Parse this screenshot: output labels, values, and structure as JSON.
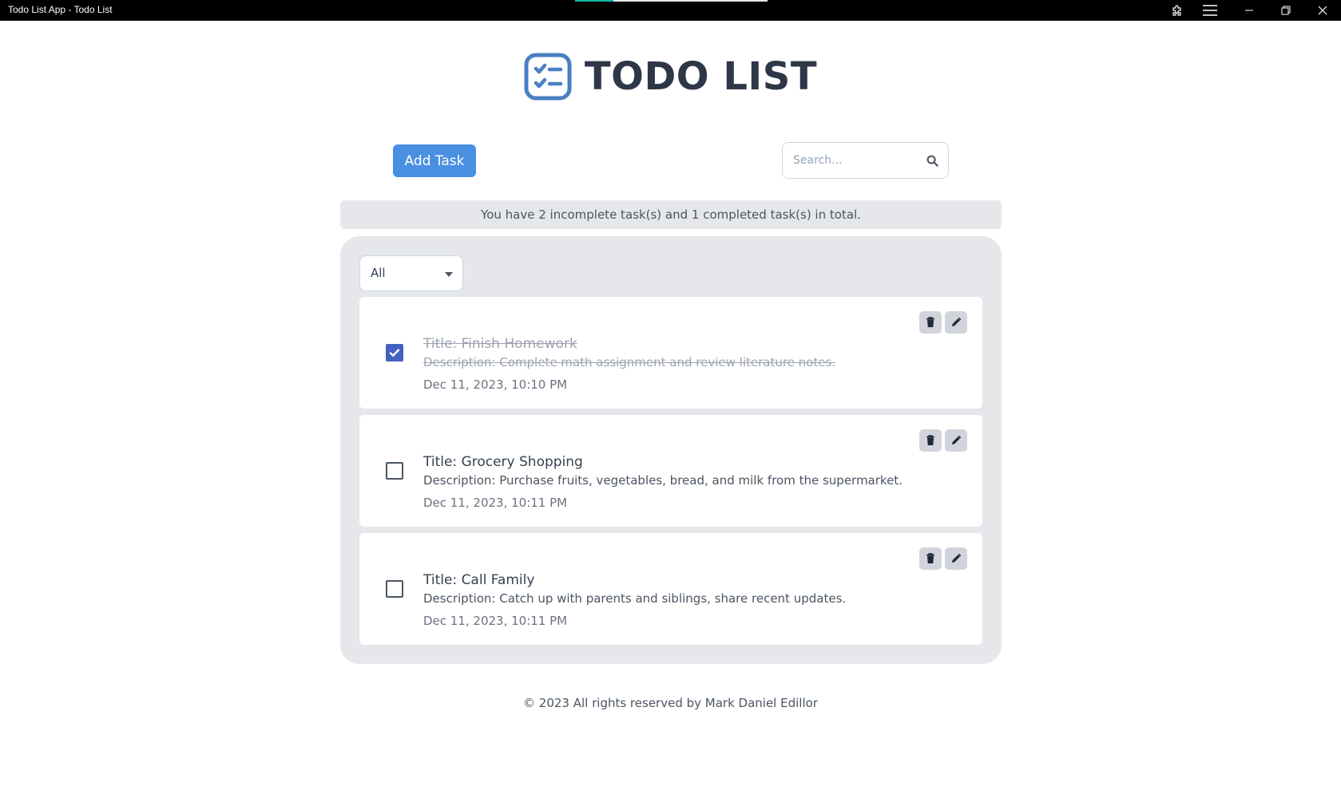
{
  "window": {
    "title": "Todo List App - Todo List",
    "loading_progress": 0.2
  },
  "header": {
    "title": "TODO LIST",
    "logo_icon": "checklist-icon",
    "accent_color": "#4a7fc1"
  },
  "toolbar": {
    "add_task_label": "Add Task",
    "search_placeholder": "Search...",
    "search_value": "",
    "primary_color": "#4a90e2"
  },
  "summary": {
    "text": "You have 2 incomplete task(s) and 1 completed task(s) in total."
  },
  "filter": {
    "selected": "All"
  },
  "tasks": [
    {
      "title": "Title: Finish Homework",
      "description": "Description: Complete math assignment and review literature notes.",
      "date": "Dec 11, 2023, 10:10 PM",
      "completed": true
    },
    {
      "title": "Title: Grocery Shopping",
      "description": "Description: Purchase fruits, vegetables, bread, and milk from the supermarket.",
      "date": "Dec 11, 2023, 10:11 PM",
      "completed": false
    },
    {
      "title": "Title: Call Family",
      "description": "Description: Catch up with parents and siblings, share recent updates.",
      "date": "Dec 11, 2023, 10:11 PM",
      "completed": false
    }
  ],
  "footer": {
    "text": "© 2023 All rights reserved by Mark Daniel Edillor"
  }
}
